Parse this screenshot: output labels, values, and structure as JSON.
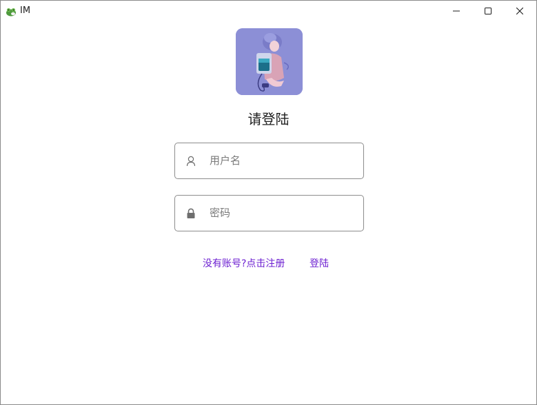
{
  "window": {
    "title": "IM",
    "app_icon": "frog-app-icon",
    "controls": {
      "minimize_icon": "minimize-icon",
      "maximize_icon": "maximize-icon",
      "close_icon": "close-icon"
    }
  },
  "login": {
    "avatar": "anime-girl-avatar",
    "heading": "请登陆",
    "username": {
      "placeholder": "用户名",
      "value": "",
      "icon": "user-icon"
    },
    "password": {
      "placeholder": "密码",
      "value": "",
      "icon": "lock-icon"
    },
    "register_link": "没有账号?点击注册",
    "login_link": "登陆"
  },
  "colors": {
    "link": "#6c1fd1",
    "avatar_bg": "#8c8fd6",
    "field_border": "#8c8c8c"
  }
}
